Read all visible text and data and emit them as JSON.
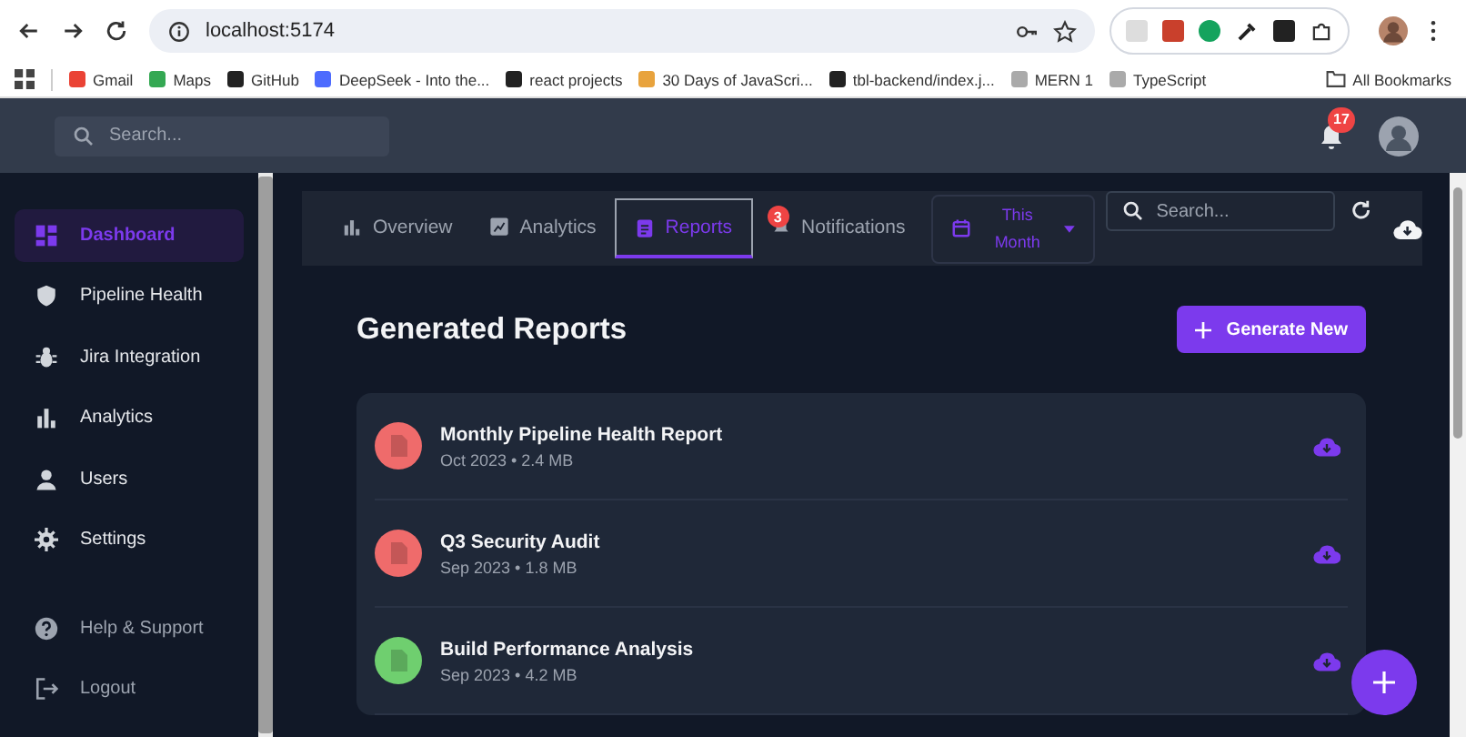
{
  "browser": {
    "url": "localhost:5174",
    "bookmarks": [
      "Gmail",
      "Maps",
      "GitHub",
      "DeepSeek - Into the...",
      "react projects",
      "30 Days of JavaScri...",
      "tbl-backend/index.j...",
      "MERN 1",
      "TypeScript"
    ],
    "all_bookmarks": "All Bookmarks"
  },
  "header": {
    "search": {
      "placeholder": "Search..."
    },
    "notification_count": "17"
  },
  "sidebar": {
    "items": [
      {
        "label": "Dashboard",
        "selected": true
      },
      {
        "label": "Pipeline Health",
        "selected": false
      },
      {
        "label": "Jira Integration",
        "selected": false
      },
      {
        "label": "Analytics",
        "selected": false
      },
      {
        "label": "Users",
        "selected": false
      },
      {
        "label": "Settings",
        "selected": false
      }
    ],
    "footer_items": [
      {
        "label": "Help & Support"
      },
      {
        "label": "Logout"
      }
    ]
  },
  "tabs": [
    {
      "label": "Overview",
      "selected": false
    },
    {
      "label": "Analytics",
      "selected": false
    },
    {
      "label": "Reports",
      "selected": true
    },
    {
      "label": "Notifications",
      "selected": false,
      "badge": "3"
    }
  ],
  "date_filter": "This Month",
  "toolbar_search": {
    "placeholder": "Search..."
  },
  "title": "Generated Reports",
  "generate_button": "Generate New",
  "reports": [
    {
      "name": "Monthly Pipeline Health Report",
      "meta": "Oct 2023 • 2.4 MB",
      "color": "#ef6b6b"
    },
    {
      "name": "Q3 Security Audit",
      "meta": "Sep 2023 • 1.8 MB",
      "color": "#ef6b6b"
    },
    {
      "name": "Build Performance Analysis",
      "meta": "Sep 2023 • 4.2 MB",
      "color": "#6fcf6f"
    }
  ]
}
